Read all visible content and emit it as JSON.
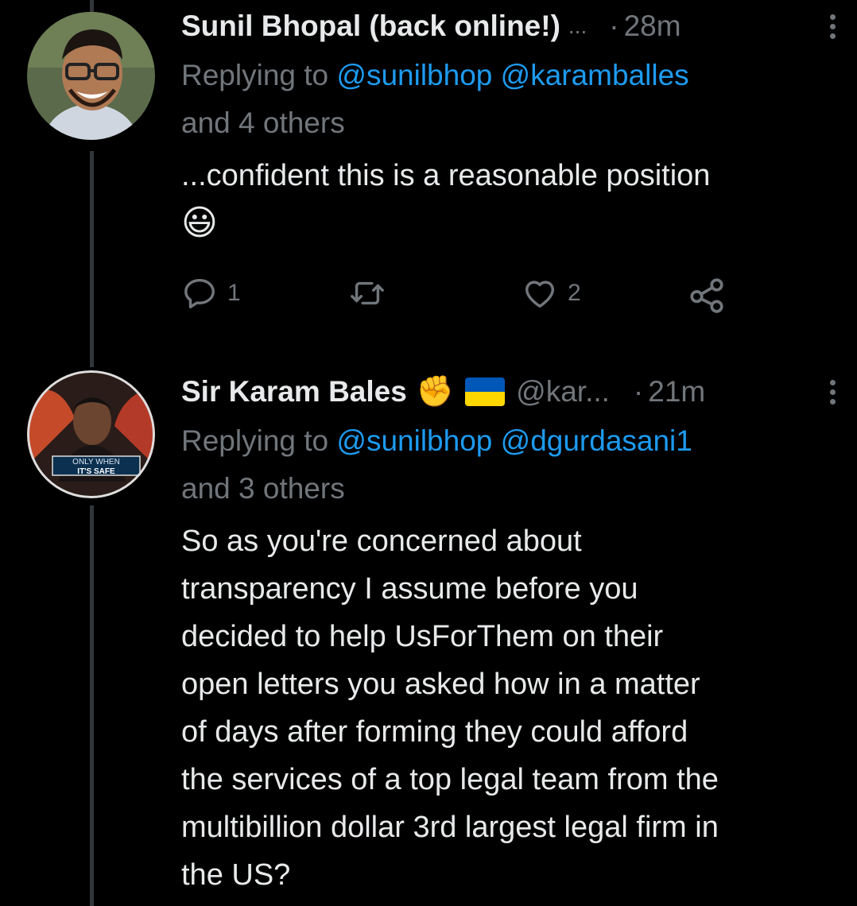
{
  "tweets": [
    {
      "display_name": "Sunil Bhopal (back online!)",
      "name_ellipsis": "...",
      "separator": "·",
      "time": "28m",
      "replying_prefix": "Replying to",
      "replying_handles": "@sunilbhop @karamballes",
      "replying_others": "and 4 others",
      "text": "...confident this is a reasonable position",
      "emoji": "😃",
      "reply_count": "1",
      "retweet_count": "",
      "like_count": "2"
    },
    {
      "display_name": "Sir Karam Bales",
      "name_emojis": "✊",
      "handle": "@kar...",
      "separator": "·",
      "time": "21m",
      "replying_prefix": "Replying to",
      "replying_handles": "@sunilbhop @dgurdasani1",
      "replying_others": "and 3 others",
      "text_lines": [
        "So as you're concerned about",
        "transparency I assume before you",
        "decided to help UsForThem on their",
        "open letters you asked how in a matter",
        "of days after forming they could afford",
        "the services of a top legal team from the",
        "multibillion dollar 3rd largest legal firm in",
        "the US?"
      ],
      "avatar_text_line1": "ONLY WHEN",
      "avatar_text_line2": "IT'S SAFE"
    }
  ],
  "colors": {
    "background": "#000000",
    "text": "#e7e9ea",
    "muted": "#71767b",
    "link": "#1d9bf0",
    "thread_line": "#333639"
  },
  "icons": [
    "reply-icon",
    "retweet-icon",
    "like-icon",
    "share-icon",
    "more-icon",
    "raised-fist-emoji",
    "ukraine-flag-emoji",
    "grinning-face-emoji"
  ]
}
